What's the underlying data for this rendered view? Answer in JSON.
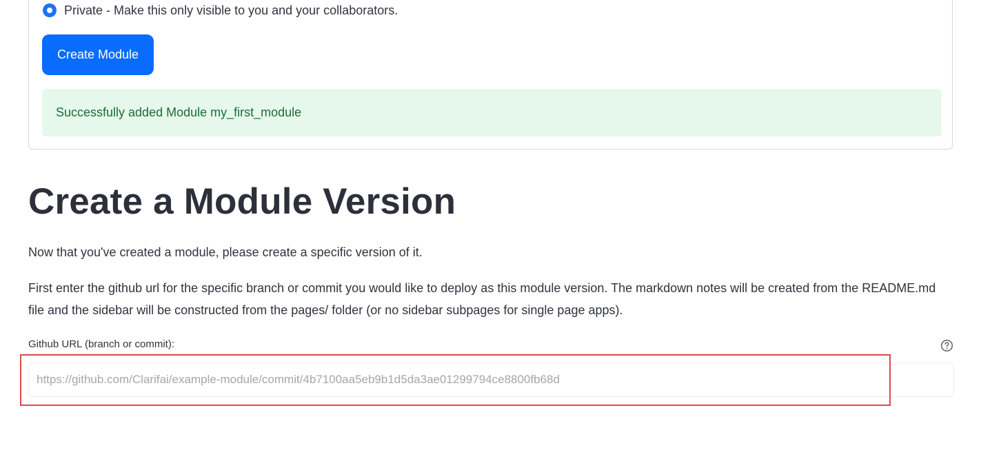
{
  "visibility": {
    "selected_option_label": "Private - Make this only visible to you and your collaborators."
  },
  "create_module": {
    "button_label": "Create Module",
    "success_message": "Successfully added Module my_first_module"
  },
  "module_version": {
    "title": "Create a Module Version",
    "intro": "Now that you've created a module, please create a specific version of it.",
    "instructions": "First enter the github url for the specific branch or commit you would like to deploy as this module version. The markdown notes will be created from the README.md file and the sidebar will be constructed from the pages/ folder (or no sidebar subpages for single page apps).",
    "github_url": {
      "label": "Github URL (branch or commit):",
      "value": "",
      "placeholder": "https://github.com/Clarifai/example-module/commit/4b7100aa5eb9b1d5da3ae01299794ce8800fb68d",
      "help_icon": "question-circle-icon"
    }
  },
  "colors": {
    "accent": "#0a6cff",
    "radio": "#1a73f5",
    "success_bg": "#e6f8ec",
    "success_text": "#1e6b34",
    "highlight": "#e0484b"
  }
}
